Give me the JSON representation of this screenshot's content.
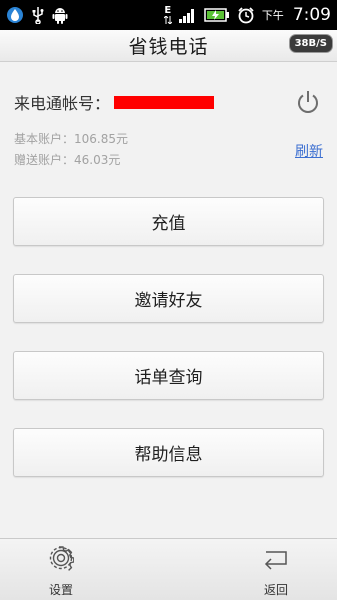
{
  "status_bar": {
    "network_label": "E",
    "ampm": "下午",
    "time": "7:09"
  },
  "header": {
    "title": "省钱电话",
    "speed_badge": "38B/S"
  },
  "account": {
    "label": "来电通帐号：",
    "basic_balance": "基本账户：106.85元",
    "gift_balance": "赠送账户：46.03元",
    "refresh_label": "刷新"
  },
  "menu": {
    "recharge": "充值",
    "invite": "邀请好友",
    "bill_query": "话单查询",
    "help": "帮助信息"
  },
  "bottom_bar": {
    "settings_label": "设置",
    "back_label": "返回"
  },
  "colors": {
    "link": "#3c6fd1",
    "redaction": "#ff0000"
  }
}
